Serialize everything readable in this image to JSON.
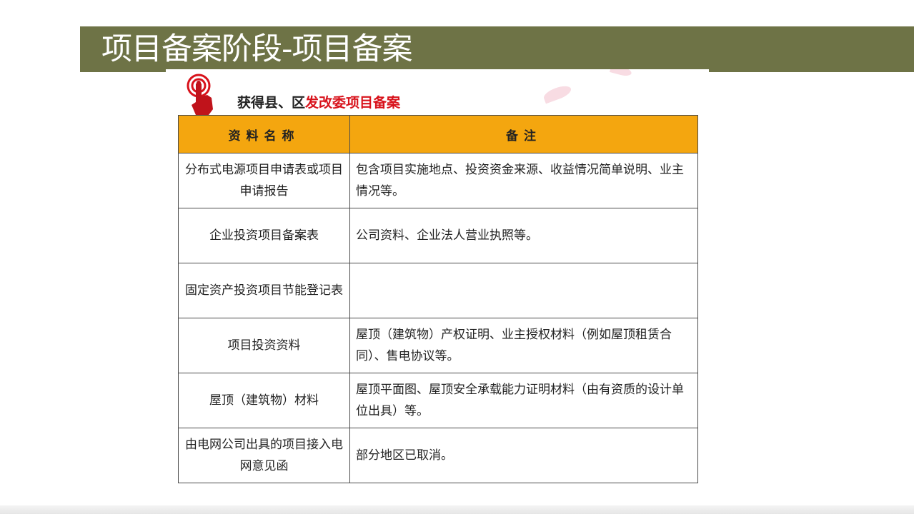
{
  "slide": {
    "title": "项目备案阶段-项目备案"
  },
  "heading": {
    "prefix": "获得县、区",
    "highlight": "发改委项目备案",
    "icon": "pointing-hand-icon",
    "highlight_color": "#d8121b"
  },
  "table": {
    "header_color": "#f4a60f",
    "headers": [
      "资料名称",
      "备注"
    ],
    "rows": [
      {
        "name": "分布式电源项目申请表或项目申请报告",
        "note": "包含项目实施地点、投资资金来源、收益情况简单说明、业主情况等。"
      },
      {
        "name": "企业投资项目备案表",
        "note": "公司资料、企业法人营业执照等。"
      },
      {
        "name": "固定资产投资项目节能登记表",
        "note": ""
      },
      {
        "name": "项目投资资料",
        "note": "屋顶（建筑物）产权证明、业主授权材料（例如屋顶租赁合同）、售电协议等。"
      },
      {
        "name": "屋顶（建筑物）材料",
        "note": "屋顶平面图、屋顶安全承载能力证明材料（由有资质的设计单位出具）等。"
      },
      {
        "name": "由电网公司出具的项目接入电网意见函",
        "note": "部分地区已取消。"
      }
    ]
  }
}
